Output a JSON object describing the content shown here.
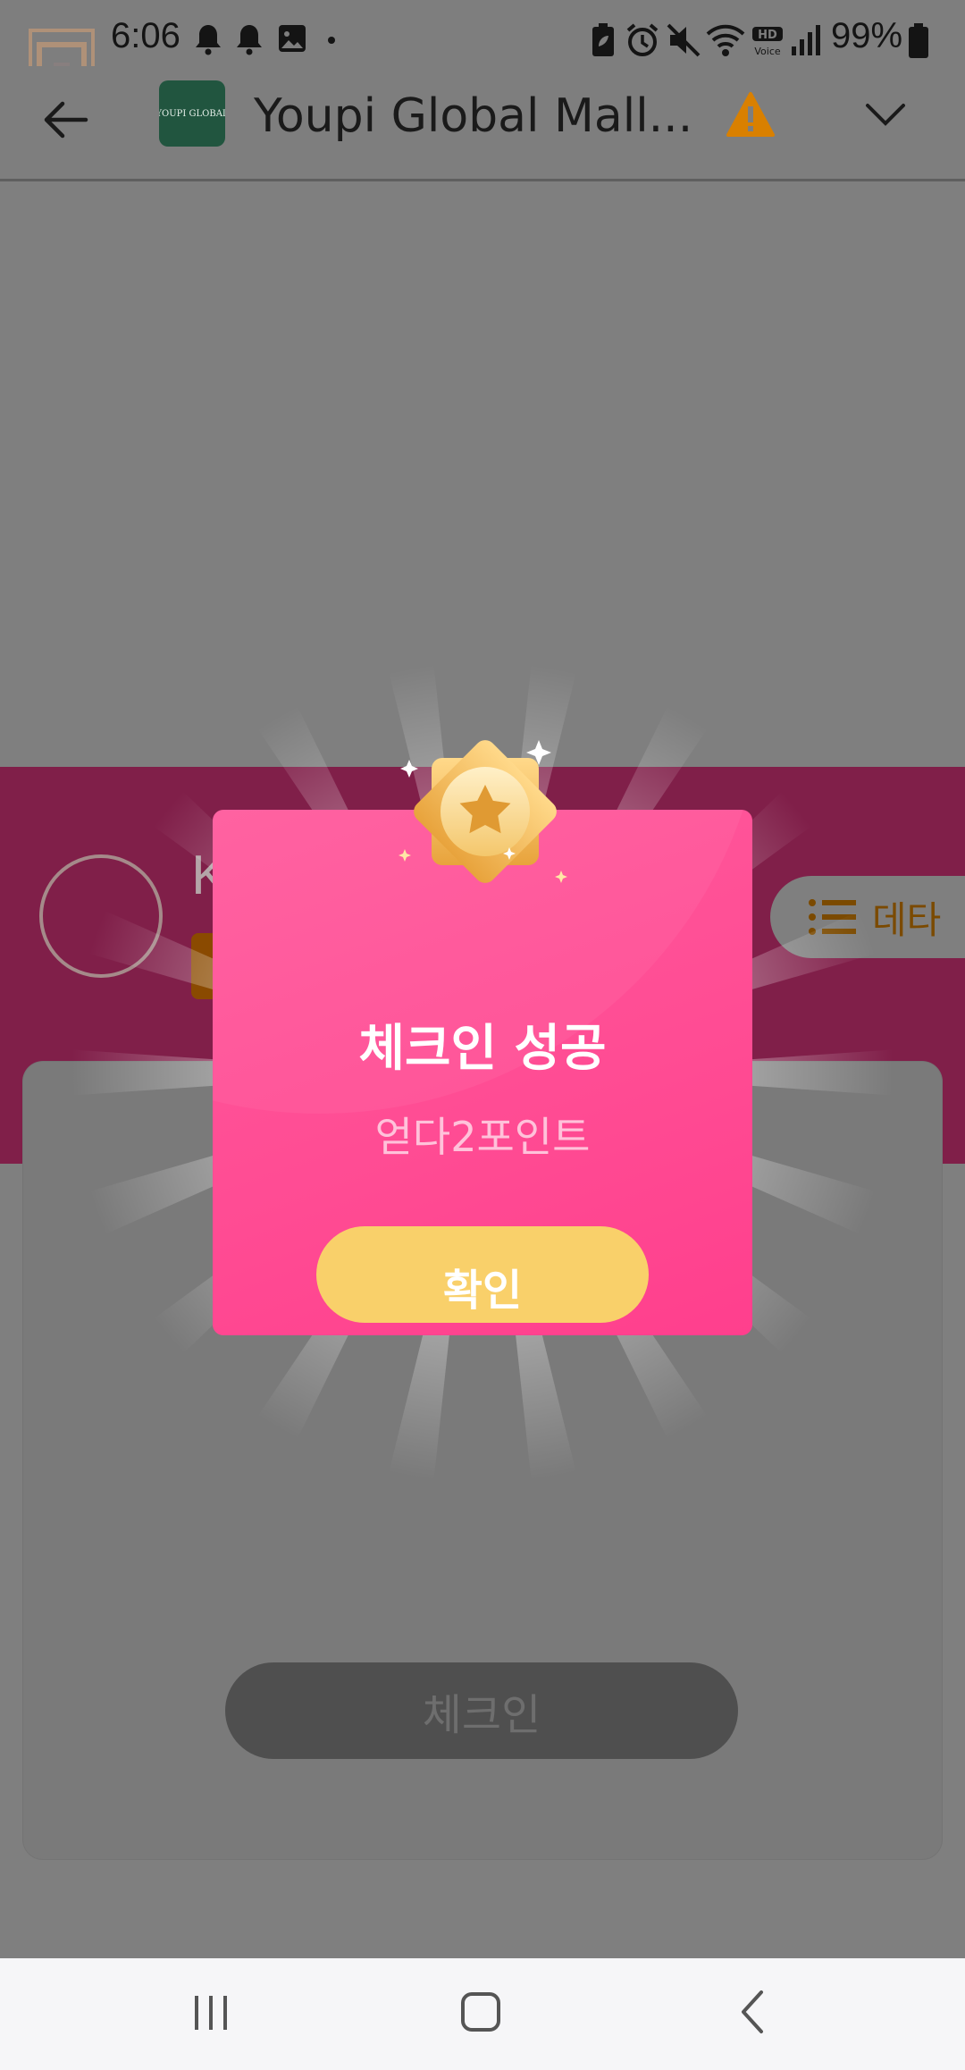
{
  "status_bar": {
    "time": "6:06",
    "battery": "99%",
    "icons": [
      "notification-bell-icon",
      "notification-bell-icon",
      "image-icon",
      "dot-icon",
      "battery-saver-icon",
      "alarm-icon",
      "mute-icon",
      "wifi-icon",
      "hd-voice-icon",
      "signal-icon",
      "battery-icon"
    ]
  },
  "header": {
    "title": "Youpi Global Mall...",
    "logo_text": "YOUPI GLOBAL"
  },
  "page": {
    "name_fragment": "K",
    "detail_button": "데타",
    "checkin_button": "체크인"
  },
  "modal": {
    "title": "체크인 성공",
    "subtitle": "얻다2포인트",
    "confirm_button": "확인"
  },
  "colors": {
    "modal_pink": "#ff4b93",
    "confirm_yellow": "#f9d06a",
    "profile_band": "#801f49",
    "badge_gold": "#e8a33c"
  }
}
